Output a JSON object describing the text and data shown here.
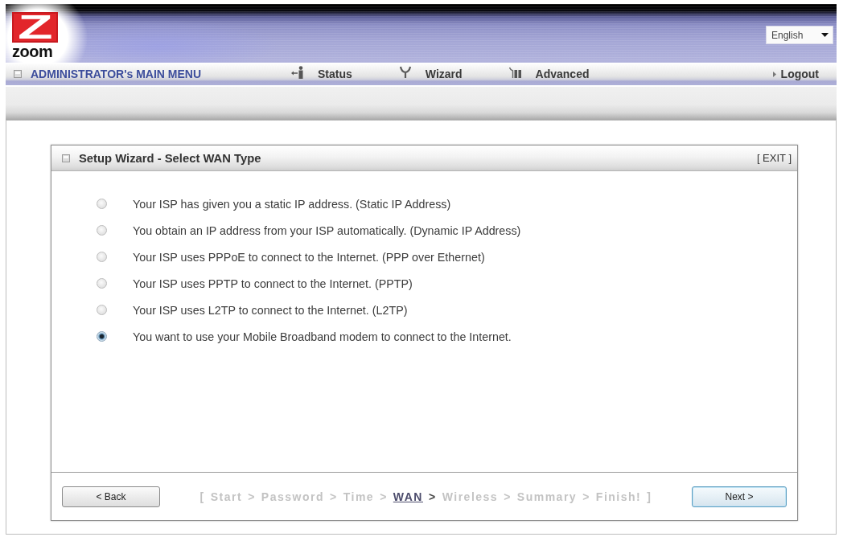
{
  "header": {
    "logo": {
      "mark": "Z",
      "text": "zoom"
    },
    "language": "English"
  },
  "menu_bar": {
    "title": "ADMINISTRATOR's MAIN MENU",
    "items": [
      {
        "label": "Status",
        "kind": "status"
      },
      {
        "label": "Wizard",
        "kind": "wizard"
      },
      {
        "label": "Advanced",
        "kind": "advanced"
      },
      {
        "label": "Logout",
        "kind": "logout"
      }
    ]
  },
  "panel": {
    "title": "Setup Wizard - Select WAN Type",
    "exit": "[ EXIT ]",
    "wan_types": [
      {
        "label": "Your ISP has given you a static IP address. (Static IP Address)",
        "selected": false
      },
      {
        "label": "You obtain an IP address from your ISP automatically. (Dynamic IP Address)",
        "selected": false
      },
      {
        "label": "Your ISP uses PPPoE to connect to the Internet. (PPP over Ethernet)",
        "selected": false
      },
      {
        "label": "Your ISP uses PPTP to connect to the Internet. (PPTP)",
        "selected": false
      },
      {
        "label": "Your ISP uses L2TP to connect to the Internet. (L2TP)",
        "selected": false
      },
      {
        "label": "You want to use your Mobile Broadband modem to connect to the Internet.",
        "selected": true
      }
    ],
    "footer": {
      "back": {
        "label": "< Back",
        "default": false
      },
      "steps": {
        "open": "[",
        "items": [
          {
            "label": "Start",
            "current": false,
            "separator": ">"
          },
          {
            "label": "Password",
            "current": false,
            "separator": ">"
          },
          {
            "label": "Time",
            "current": false,
            "separator": ">"
          },
          {
            "label": "WAN",
            "current": true,
            "separator": ">"
          },
          {
            "label": "Wireless",
            "current": false,
            "separator": ">"
          },
          {
            "label": "Summary",
            "current": false,
            "separator": ">"
          },
          {
            "label": "Finish!",
            "current": false
          }
        ],
        "close": "]"
      },
      "next": {
        "label": "Next >",
        "default": true
      }
    }
  }
}
